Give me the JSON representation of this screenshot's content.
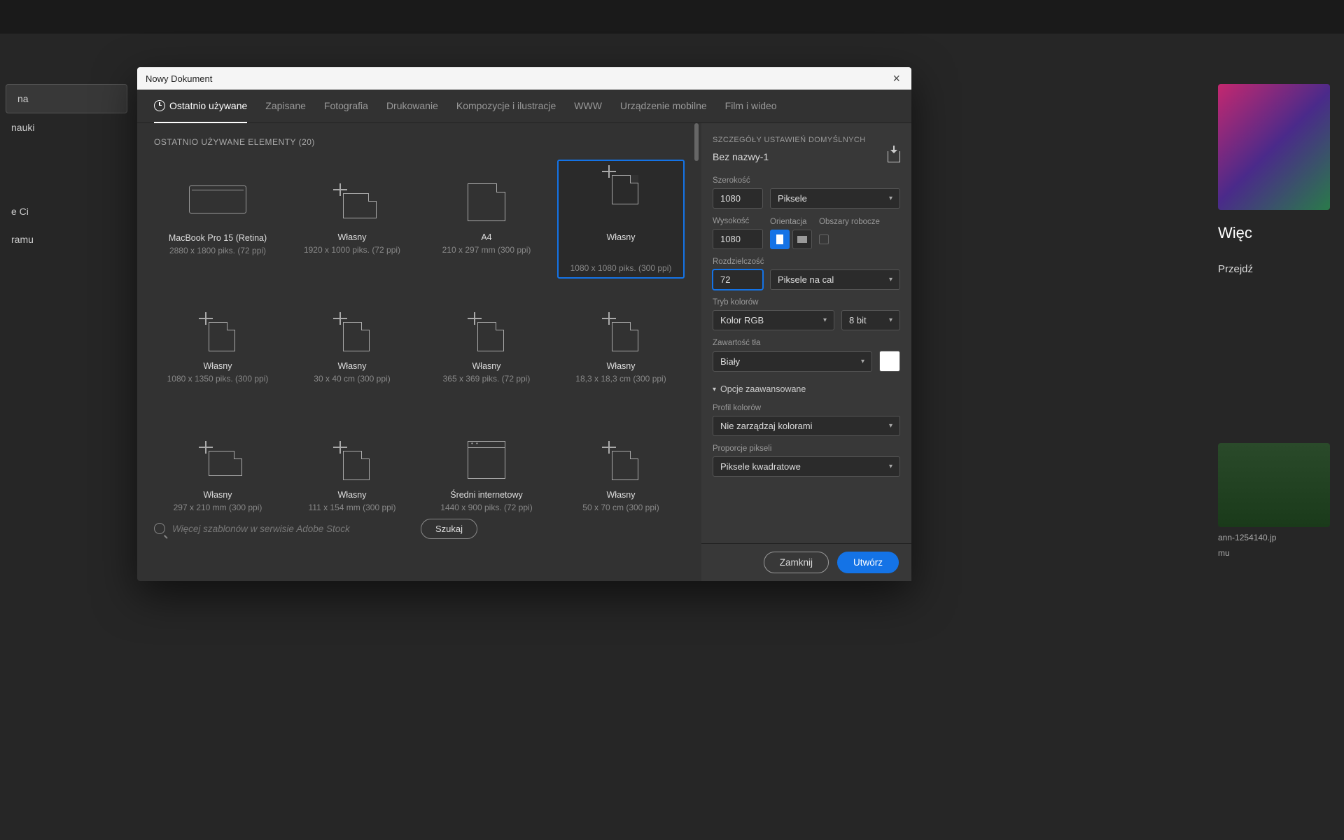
{
  "dialog_title": "Nowy Dokument",
  "tabs": [
    "Ostatnio używane",
    "Zapisane",
    "Fotografia",
    "Drukowanie",
    "Kompozycje i ilustracje",
    "WWW",
    "Urządzenie mobilne",
    "Film i wideo"
  ],
  "presets_header": "OSTATNIO UŻYWANE ELEMENTY  (20)",
  "presets": [
    {
      "name": "MacBook Pro 15 (Retina)",
      "dim": "2880 x 1800 piks. (72 ppi)",
      "icon": "laptop"
    },
    {
      "name": "Własny",
      "dim": "1920 x 1000 piks. (72 ppi)",
      "icon": "custom-wide"
    },
    {
      "name": "A4",
      "dim": "210 x 297 mm (300 ppi)",
      "icon": "doc"
    },
    {
      "name": "Własny",
      "dim": "1080 x 1080 piks. (300 ppi)",
      "icon": "custom",
      "selected": true
    },
    {
      "name": "Własny",
      "dim": "1080 x 1350 piks. (300 ppi)",
      "icon": "custom"
    },
    {
      "name": "Własny",
      "dim": "30 x 40 cm (300 ppi)",
      "icon": "custom"
    },
    {
      "name": "Własny",
      "dim": "365 x 369 piks. (72 ppi)",
      "icon": "custom"
    },
    {
      "name": "Własny",
      "dim": "18,3 x 18,3 cm (300 ppi)",
      "icon": "custom"
    },
    {
      "name": "Własny",
      "dim": "297 x 210 mm (300 ppi)",
      "icon": "custom-wide"
    },
    {
      "name": "Własny",
      "dim": "111 x 154 mm (300 ppi)",
      "icon": "custom"
    },
    {
      "name": "Średni internetowy",
      "dim": "1440 x 900 piks. (72 ppi)",
      "icon": "browser"
    },
    {
      "name": "Własny",
      "dim": "50 x 70 cm (300 ppi)",
      "icon": "custom"
    }
  ],
  "details": {
    "title": "SZCZEGÓŁY USTAWIEŃ DOMYŚLNYCH",
    "name": "Bez nazwy-1",
    "width_label": "Szerokość",
    "width": "1080",
    "units": "Piksele",
    "height_label": "Wysokość",
    "height": "1080",
    "orientation_label": "Orientacja",
    "artboards_label": "Obszary robocze",
    "resolution_label": "Rozdzielczość",
    "resolution": "72",
    "resolution_units": "Piksele na cal",
    "color_mode_label": "Tryb kolorów",
    "color_mode": "Kolor RGB",
    "bit_depth": "8 bit",
    "bg_label": "Zawartość tła",
    "bg": "Biały",
    "advanced": "Opcje zaawansowane",
    "color_profile_label": "Profil kolorów",
    "color_profile": "Nie zarządzaj kolorami",
    "pixel_ratio_label": "Proporcje pikseli",
    "pixel_ratio": "Piksele kwadratowe"
  },
  "search": {
    "placeholder": "Więcej szablonów w serwisie Adobe Stock",
    "button": "Szukaj"
  },
  "footer": {
    "close": "Zamknij",
    "create": "Utwórz"
  },
  "bg_sidebar": {
    "item1": "na",
    "item2": "nauki",
    "item3": "e Ci",
    "item4": "ramu"
  },
  "bg_right": {
    "more": "Więc",
    "go": "Przejdź",
    "caption": "ann-1254140.jp",
    "caption2": "mu"
  }
}
